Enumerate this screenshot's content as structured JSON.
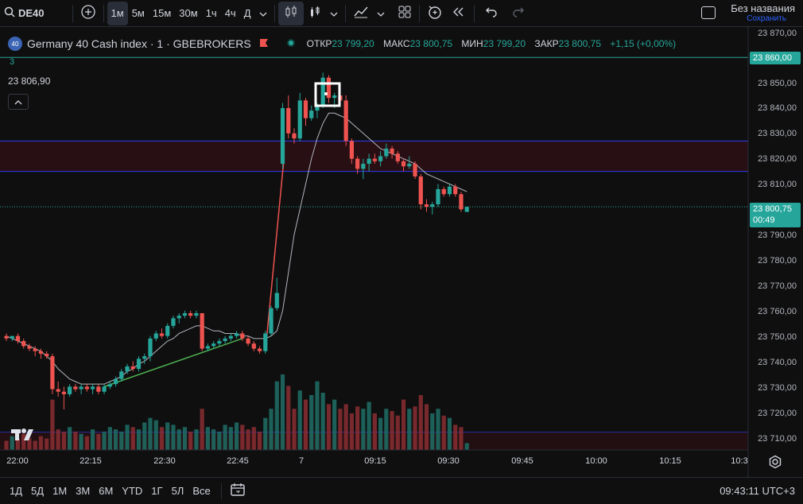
{
  "toolbar": {
    "symbol": "DE40",
    "intervals": [
      "1м",
      "5м",
      "15м",
      "30м",
      "1ч",
      "4ч",
      "Д"
    ],
    "active_interval": "1м",
    "layout_title": "Без названия",
    "save_label": "Сохранить"
  },
  "legend": {
    "badge": "40",
    "title": "Germany 40 Cash index · 1 · GBEBROKERS",
    "open_label": "ОТКР",
    "open": "23 799,20",
    "high_label": "МАКС",
    "high": "23 800,75",
    "low_label": "МИН",
    "low": "23 799,20",
    "close_label": "ЗАКР",
    "close": "23 800,75",
    "change": "+1,15 (+0,00%)",
    "indicator_value": "3",
    "crosshair_price": "23 806,90"
  },
  "price_axis": {
    "ticks": [
      "23 870,00",
      "23 850,00",
      "23 840,00",
      "23 830,00",
      "23 820,00",
      "23 810,00",
      "23 790,00",
      "23 780,00",
      "23 770,00",
      "23 760,00",
      "23 750,00",
      "23 740,00",
      "23 730,00",
      "23 720,00",
      "23 710,00"
    ],
    "alert_price": "23 860,00",
    "last_price": "23 800,75",
    "countdown": "00:49"
  },
  "time_axis": [
    "22:00",
    "22:15",
    "22:30",
    "22:45",
    "7",
    "09:15",
    "09:30",
    "09:45",
    "10:00",
    "10:15",
    "10:3"
  ],
  "bottom": {
    "ranges": [
      "1Д",
      "5Д",
      "1М",
      "3М",
      "6М",
      "YTD",
      "1Г",
      "5Л",
      "Все"
    ],
    "clock": "09:43:11 UTC+3"
  },
  "colors": {
    "up": "#26a69a",
    "down": "#ef5350",
    "bg": "#0f0f0f",
    "accent": "#2962ff"
  },
  "chart_data": {
    "type": "candlestick",
    "ylim": [
      23705,
      23872
    ],
    "candles": [
      [
        23750,
        23751,
        23748,
        23749
      ],
      [
        23749,
        23750,
        23748,
        23750
      ],
      [
        23750,
        23751,
        23747,
        23748
      ],
      [
        23748,
        23749,
        23745,
        23746
      ],
      [
        23746,
        23747,
        23744,
        23745
      ],
      [
        23745,
        23746,
        23742,
        23744
      ],
      [
        23744,
        23745,
        23741,
        23743
      ],
      [
        23743,
        23744,
        23741,
        23742
      ],
      [
        23742,
        23743,
        23727,
        23729
      ],
      [
        23729,
        23732,
        23726,
        23728
      ],
      [
        23728,
        23730,
        23721,
        23727
      ],
      [
        23727,
        23731,
        23726,
        23730
      ],
      [
        23730,
        23731,
        23728,
        23729
      ],
      [
        23729,
        23731,
        23727,
        23730
      ],
      [
        23730,
        23731,
        23728,
        23729
      ],
      [
        23729,
        23731,
        23727,
        23730
      ],
      [
        23730,
        23731,
        23727,
        23728
      ],
      [
        23728,
        23731,
        23727,
        23730
      ],
      [
        23730,
        23732,
        23729,
        23731
      ],
      [
        23731,
        23734,
        23730,
        23733
      ],
      [
        23733,
        23737,
        23732,
        23736
      ],
      [
        23736,
        23739,
        23735,
        23738
      ],
      [
        23738,
        23740,
        23736,
        23737
      ],
      [
        23737,
        23742,
        23736,
        23741
      ],
      [
        23741,
        23743,
        23739,
        23742
      ],
      [
        23742,
        23750,
        23740,
        23749
      ],
      [
        23749,
        23752,
        23748,
        23751
      ],
      [
        23751,
        23753,
        23749,
        23750
      ],
      [
        23750,
        23755,
        23749,
        23754
      ],
      [
        23754,
        23758,
        23753,
        23757
      ],
      [
        23757,
        23759,
        23755,
        23758
      ],
      [
        23758,
        23760,
        23757,
        23759
      ],
      [
        23759,
        23760,
        23757,
        23758
      ],
      [
        23758,
        23760,
        23757,
        23759
      ],
      [
        23759,
        23759,
        23744,
        23745
      ],
      [
        23745,
        23747,
        23744,
        23746
      ],
      [
        23746,
        23748,
        23745,
        23747
      ],
      [
        23747,
        23749,
        23746,
        23748
      ],
      [
        23748,
        23750,
        23747,
        23749
      ],
      [
        23749,
        23751,
        23748,
        23750
      ],
      [
        23750,
        23752,
        23749,
        23751
      ],
      [
        23751,
        23752,
        23748,
        23749
      ],
      [
        23749,
        23750,
        23746,
        23747
      ],
      [
        23747,
        23748,
        23744,
        23745
      ],
      [
        23745,
        23746,
        23743,
        23744
      ],
      [
        23744,
        23752,
        23743,
        23751
      ],
      [
        23751,
        23762,
        23750,
        23761
      ],
      [
        23761,
        23773,
        23760,
        23767
      ],
      [
        23818,
        23842,
        23816,
        23840
      ],
      [
        23840,
        23845,
        23828,
        23830
      ],
      [
        23830,
        23832,
        23826,
        23828
      ],
      [
        23828,
        23846,
        23827,
        23843
      ],
      [
        23843,
        23844,
        23833,
        23836
      ],
      [
        23836,
        23841,
        23835,
        23839
      ],
      [
        23839,
        23842,
        23836,
        23841
      ],
      [
        23841,
        23854,
        23840,
        23852
      ],
      [
        23852,
        23853,
        23842,
        23844
      ],
      [
        23844,
        23846,
        23840,
        23845
      ],
      [
        23845,
        23847,
        23842,
        23843
      ],
      [
        23843,
        23845,
        23825,
        23827
      ],
      [
        23827,
        23828,
        23818,
        23820
      ],
      [
        23820,
        23821,
        23814,
        23816
      ],
      [
        23816,
        23820,
        23812,
        23818
      ],
      [
        23818,
        23822,
        23815,
        23820
      ],
      [
        23820,
        23822,
        23818,
        23819
      ],
      [
        23819,
        23823,
        23817,
        23821
      ],
      [
        23821,
        23826,
        23820,
        23824
      ],
      [
        23824,
        23825,
        23820,
        23822
      ],
      [
        23822,
        23823,
        23818,
        23819
      ],
      [
        23819,
        23820,
        23815,
        23817
      ],
      [
        23817,
        23821,
        23816,
        23818
      ],
      [
        23818,
        23819,
        23812,
        23813
      ],
      [
        23813,
        23814,
        23800,
        23802
      ],
      [
        23802,
        23804,
        23799,
        23801
      ],
      [
        23801,
        23803,
        23798,
        23802
      ],
      [
        23802,
        23810,
        23801,
        23808
      ],
      [
        23808,
        23809,
        23805,
        23806
      ],
      [
        23806,
        23810,
        23805,
        23809
      ],
      [
        23809,
        23810,
        23805,
        23806
      ],
      [
        23806,
        23807,
        23799,
        23800
      ],
      [
        23799,
        23801,
        23799,
        23801
      ]
    ],
    "ma": [
      23750,
      23749,
      23748,
      23747,
      23746,
      23745,
      23744,
      23742,
      23740,
      23737,
      23735,
      23733,
      23732,
      23731,
      23731,
      23731,
      23731,
      23731,
      23732,
      23733,
      23734,
      23736,
      23737,
      23739,
      23740,
      23742,
      23744,
      23746,
      23748,
      23749,
      23751,
      23752,
      23753,
      23754,
      23754,
      23753,
      23752,
      23752,
      23751,
      23751,
      23751,
      23750,
      23750,
      23749,
      23749,
      23749,
      23750,
      23752,
      23760,
      23775,
      23790,
      23800,
      23810,
      23820,
      23828,
      23834,
      23838,
      23838,
      23837,
      23836,
      23834,
      23832,
      23830,
      23828,
      23826,
      23824,
      23823,
      23822,
      23821,
      23820,
      23819,
      23818,
      23816,
      23814,
      23813,
      23812,
      23811,
      23810,
      23809,
      23808,
      23807
    ],
    "volume": [
      4,
      6,
      5,
      7,
      5,
      4,
      6,
      5,
      22,
      9,
      8,
      10,
      8,
      7,
      6,
      9,
      7,
      8,
      10,
      9,
      8,
      11,
      10,
      9,
      12,
      14,
      13,
      10,
      12,
      11,
      9,
      10,
      8,
      9,
      18,
      10,
      9,
      8,
      11,
      10,
      12,
      11,
      9,
      10,
      8,
      14,
      18,
      30,
      33,
      28,
      18,
      26,
      22,
      24,
      30,
      25,
      20,
      22,
      18,
      20,
      16,
      19,
      18,
      21,
      16,
      14,
      18,
      17,
      15,
      22,
      18,
      19,
      24,
      20,
      16,
      18,
      15,
      14,
      11,
      10,
      3
    ],
    "horizontal_lines": [
      23827,
      23815,
      23712
    ],
    "alert_line": 23860
  }
}
